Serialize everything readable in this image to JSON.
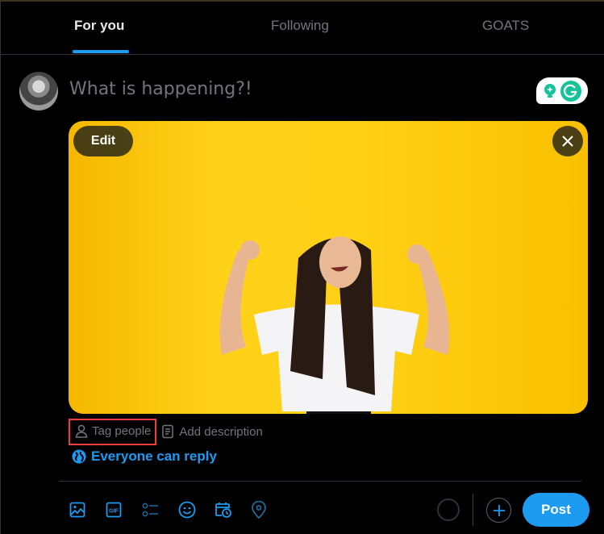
{
  "tabs": [
    {
      "label": "For you",
      "active": true
    },
    {
      "label": "Following",
      "active": false
    },
    {
      "label": "GOATS",
      "active": false
    }
  ],
  "composer": {
    "placeholder": "What is happening?!",
    "avatar_icon": "user-avatar"
  },
  "grammarly": {
    "icons": [
      "lightbulb-icon",
      "grammarly-g-icon"
    ]
  },
  "media": {
    "edit_label": "Edit",
    "close_icon": "close-icon",
    "description": "Woman with long dark hair in white t-shirt pointing up on yellow background"
  },
  "media_actions": {
    "tag_people": "Tag people",
    "add_description": "Add description"
  },
  "reply_setting": "Everyone can reply",
  "toolbar": {
    "icons": [
      "image-icon",
      "gif-icon",
      "poll-icon",
      "emoji-icon",
      "schedule-icon",
      "location-icon"
    ],
    "post_label": "Post"
  },
  "colors": {
    "accent": "#1d9bf0",
    "background": "#000000",
    "muted_text": "#71767b",
    "highlight_box": "#f23b3b"
  }
}
